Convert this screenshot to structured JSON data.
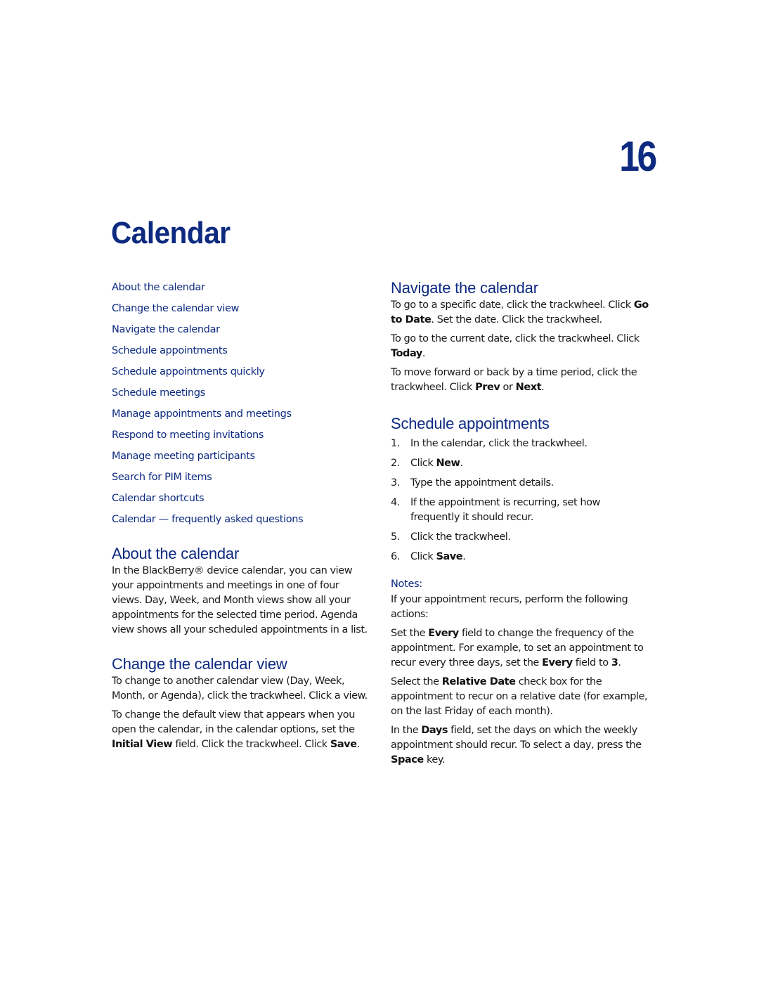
{
  "chapter": {
    "number": "16",
    "title": "Calendar"
  },
  "toc": [
    "About the calendar",
    "Change the calendar view",
    "Navigate the calendar",
    "Schedule appointments",
    "Schedule appointments quickly",
    "Schedule meetings",
    "Manage appointments and meetings",
    "Respond to meeting invitations",
    "Manage meeting participants",
    "Search for PIM items",
    "Calendar shortcuts",
    "Calendar — frequently asked questions"
  ],
  "about": {
    "heading": "About the calendar",
    "body": "In the BlackBerry® device calendar, you can view your appointments and meetings in one of four views. Day, Week, and Month views show all your appointments for the selected time period. Agenda view shows all your scheduled appointments in a list."
  },
  "change_view": {
    "heading": "Change the calendar view",
    "p1": "To change to another calendar view (Day, Week, Month, or Agenda), click the trackwheel. Click a view.",
    "p2_pre": "To change the default view that appears when you open the calendar, in the calendar options, set the ",
    "p2_bold1": "Initial View",
    "p2_mid": " field. Click the trackwheel. Click ",
    "p2_bold2": "Save",
    "p2_post": "."
  },
  "navigate": {
    "heading": "Navigate the calendar",
    "p1_pre": "To go to a specific date, click the trackwheel. Click ",
    "p1_bold": "Go to Date",
    "p1_post": ". Set the date. Click the trackwheel.",
    "p2_pre": "To go to the current date, click the trackwheel. Click ",
    "p2_bold": "Today",
    "p2_post": ".",
    "p3_pre": "To move forward or back by a time period, click the trackwheel. Click ",
    "p3_bold1": "Prev",
    "p3_mid": " or ",
    "p3_bold2": "Next",
    "p3_post": "."
  },
  "schedule": {
    "heading": "Schedule appointments",
    "steps": [
      {
        "num": "1.",
        "pre": "In the calendar, click the trackwheel.",
        "bold": "",
        "post": ""
      },
      {
        "num": "2.",
        "pre": "Click ",
        "bold": "New",
        "post": "."
      },
      {
        "num": "3.",
        "pre": "Type the appointment details.",
        "bold": "",
        "post": ""
      },
      {
        "num": "4.",
        "pre": "If the appointment is recurring, set how frequently it should recur.",
        "bold": "",
        "post": ""
      },
      {
        "num": "5.",
        "pre": "Click the trackwheel.",
        "bold": "",
        "post": ""
      },
      {
        "num": "6.",
        "pre": "Click ",
        "bold": "Save",
        "post": "."
      }
    ],
    "notes_label": "Notes:",
    "n1": "If your appointment recurs, perform the following actions:",
    "n2_pre": "Set the ",
    "n2_bold1": "Every",
    "n2_mid": " field to change the frequency of the appointment. For example, to set an appointment to recur every three days, set the ",
    "n2_bold2": "Every",
    "n2_mid2": " field to ",
    "n2_bold3": "3",
    "n2_post": ".",
    "n3_pre": "Select the ",
    "n3_bold": "Relative Date",
    "n3_post": " check box for the appointment to recur on a relative date (for example, on the last Friday of each month).",
    "n4_pre": "In the ",
    "n4_bold1": "Days",
    "n4_mid": " field, set the days on which the weekly appointment should recur. To select a day, press the ",
    "n4_bold2": "Space",
    "n4_post": " key."
  },
  "colors": {
    "heading": "#0d2a80",
    "body_text": "#1a1a1a"
  }
}
